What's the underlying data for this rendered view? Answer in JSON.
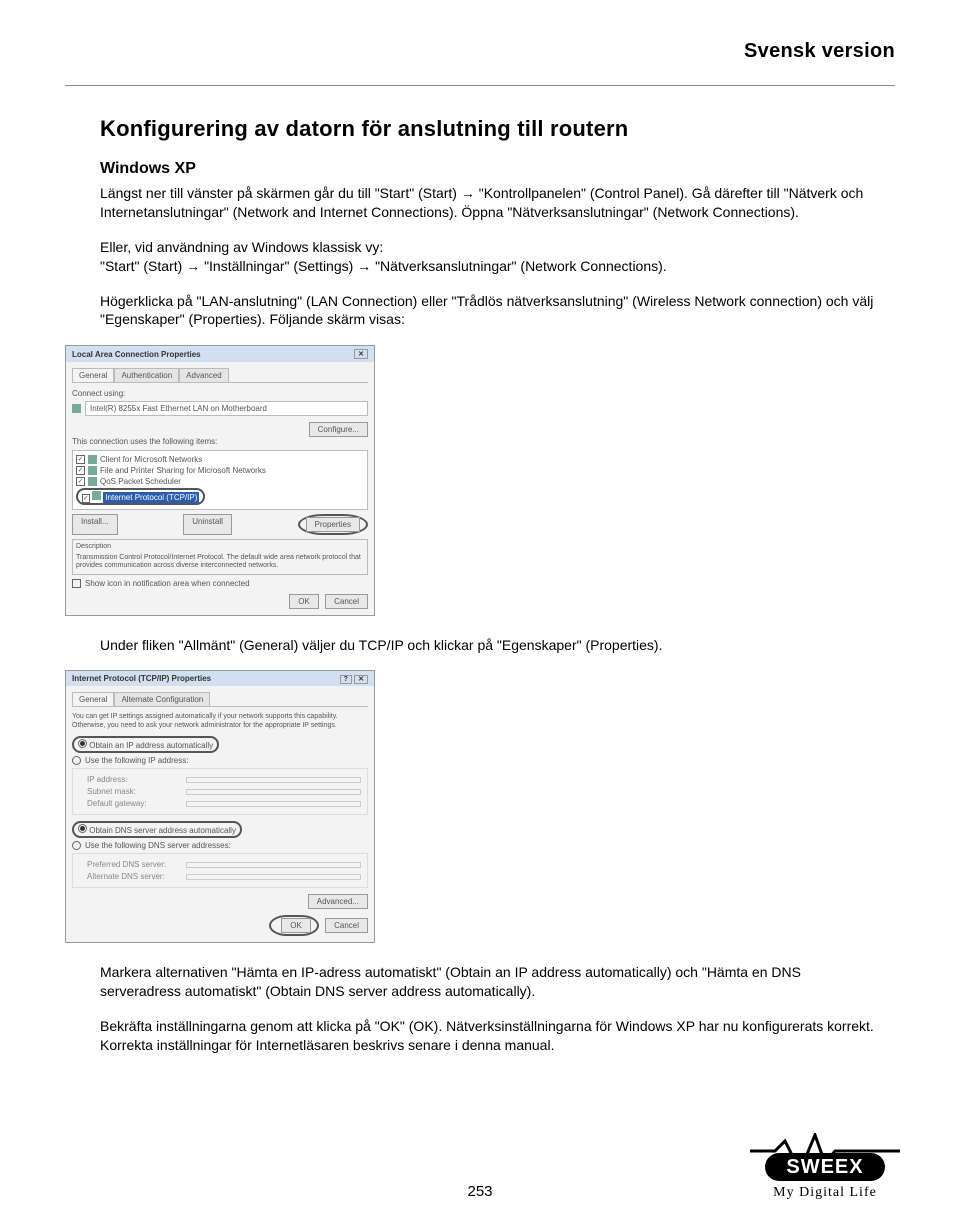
{
  "header": {
    "language_version": "Svensk version"
  },
  "section": {
    "title": "Konfigurering av datorn för anslutning till routern",
    "subtitle": "Windows XP",
    "p1": "Längst ner till vänster på skärmen går du till \"Start\" (Start) → \"Kontrollpanelen\" (Control Panel). Gå därefter till \"Nätverk och Internetanslutningar\" (Network and Internet Connections). Öppna \"Nätverksanslutningar\" (Network Connections).",
    "p2": "Eller, vid användning av Windows klassisk vy:\n\"Start\" (Start) → \"Inställningar\" (Settings) → \"Nätverksanslutningar\" (Network Connections).",
    "p3": "Högerklicka på \"LAN-anslutning\" (LAN Connection) eller \"Trådlös nätverksanslutning\" (Wireless Network connection) och välj \"Egenskaper\" (Properties). Följande skärm visas:",
    "p4": "Under fliken \"Allmänt\" (General) väljer du TCP/IP och klickar på \"Egenskaper\" (Properties).",
    "p5": "Markera alternativen \"Hämta en IP-adress automatiskt\" (Obtain an IP address automatically) och \"Hämta en DNS serveradress automatiskt\" (Obtain DNS server address automatically).",
    "p6": "Bekräfta inställningarna genom att klicka på \"OK\" (OK). Nätverksinställningarna för Windows XP har nu konfigurerats korrekt. Korrekta inställningar för Internetläsaren beskrivs senare i denna manual."
  },
  "dialog1": {
    "title": "Local Area Connection Properties",
    "tab_general": "General",
    "tab_auth": "Authentication",
    "tab_adv": "Advanced",
    "connect_using_label": "Connect using:",
    "adapter": "Intel(R) 8255x Fast Ethernet LAN on Motherboard",
    "configure_btn": "Configure...",
    "uses_text": "This connection uses the following items:",
    "item1": "Client for Microsoft Networks",
    "item2": "File and Printer Sharing for Microsoft Networks",
    "item3": "QoS Packet Scheduler",
    "item4": "Internet Protocol (TCP/IP)",
    "install_btn": "Install...",
    "uninstall_btn": "Uninstall",
    "properties_btn": "Properties",
    "desc_label": "Description",
    "desc_text": "Transmission Control Protocol/Internet Protocol. The default wide area network protocol that provides communication across diverse interconnected networks.",
    "show_icon": "Show icon in notification area when connected",
    "ok_btn": "OK",
    "cancel_btn": "Cancel"
  },
  "dialog2": {
    "title": "Internet Protocol (TCP/IP) Properties",
    "tab_general": "General",
    "tab_alt": "Alternate Configuration",
    "intro": "You can get IP settings assigned automatically if your network supports this capability. Otherwise, you need to ask your network administrator for the appropriate IP settings.",
    "opt_auto_ip": "Obtain an IP address automatically",
    "opt_static_ip": "Use the following IP address:",
    "ip_label": "IP address:",
    "subnet_label": "Subnet mask:",
    "gateway_label": "Default gateway:",
    "opt_auto_dns": "Obtain DNS server address automatically",
    "opt_static_dns": "Use the following DNS server addresses:",
    "dns1_label": "Preferred DNS server:",
    "dns2_label": "Alternate DNS server:",
    "advanced_btn": "Advanced...",
    "ok_btn": "OK",
    "cancel_btn": "Cancel"
  },
  "footer": {
    "page": "253",
    "brand": "SWEEX",
    "tagline": "My Digital Life"
  }
}
